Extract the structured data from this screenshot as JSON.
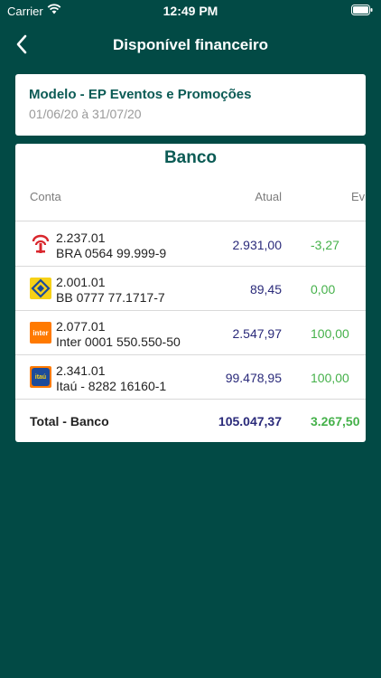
{
  "status_bar": {
    "carrier": "Carrier",
    "time": "12:49 PM"
  },
  "nav": {
    "title": "Disponível financeiro",
    "back_icon": "chevron-left-icon"
  },
  "info": {
    "title": "Modelo - EP Eventos e Promoções",
    "period": "01/06/20 à 31/07/20"
  },
  "bank": {
    "title": "Banco",
    "headers": {
      "conta": "Conta",
      "atual": "Atual",
      "ev": "Ev"
    },
    "rows": [
      {
        "code": "2.237.01",
        "name": "BRA 0564 99.999-9",
        "atual": "2.931,00",
        "ev": "-3,27",
        "logo": "bradesco-logo"
      },
      {
        "code": "2.001.01",
        "name": "BB 0777 77.1717-7",
        "atual": "89,45",
        "ev": "0,00",
        "logo": "banco-do-brasil-logo"
      },
      {
        "code": "2.077.01",
        "name": "Inter 0001 550.550-50",
        "atual": "2.547,97",
        "ev": "100,00",
        "logo": "inter-logo",
        "logo_text": "inter"
      },
      {
        "code": "2.341.01",
        "name": "Itaú - 8282 16160-1",
        "atual": "99.478,95",
        "ev": "100,00",
        "logo": "itau-logo",
        "logo_text": "itaú"
      }
    ],
    "total": {
      "label": "Total - Banco",
      "atual": "105.047,37",
      "ev": "3.267,50"
    }
  },
  "colors": {
    "background": "#024a45",
    "title_green": "#0b5b55",
    "value_blue": "#2a2a7a",
    "positive_green": "#45b14a",
    "bradesco_red": "#d9262c",
    "bb_yellow": "#f7d117",
    "inter_orange": "#ff7a00",
    "itau_blue": "#1d4b9a"
  }
}
